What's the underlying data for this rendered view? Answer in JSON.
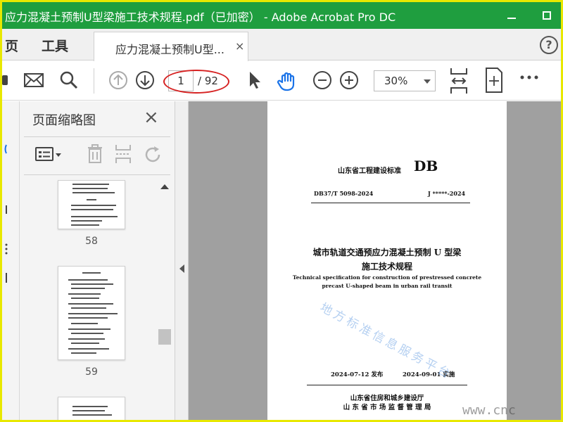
{
  "window": {
    "title": "应力混凝土预制U型梁施工技术规程.pdf（已加密） - Adobe Acrobat Pro DC"
  },
  "tabs": {
    "home": "页",
    "tools": "工具",
    "document_tab": "应力混凝土预制U型...",
    "close_symbol": "×",
    "help_symbol": "?"
  },
  "toolbar": {
    "current_page": "1",
    "total_pages": "/ 92",
    "zoom": "30%"
  },
  "thumbnail_panel": {
    "title": "页面缩略图",
    "close_symbol": "×",
    "pages": [
      {
        "label": "58"
      },
      {
        "label": "59"
      }
    ]
  },
  "document": {
    "standard_label": "山东省工程建设标准",
    "standard_code": "DB",
    "db_number": "DB37/T 5098-2024",
    "j_number": "J *****-2024",
    "cn_title_line1": "城市轨道交通预应力混凝土预制 U 型梁",
    "cn_title_line2": "施工技术规程",
    "en_title_line1": "Technical specification for construction of prestressed concrete",
    "en_title_line2": "precast U-shaped beam in urban rail transit",
    "publish_date": "2024-07-12 发布",
    "implement_date": "2024-09-01 实施",
    "issuer1": "山东省住房和城乡建设厅",
    "issuer2": "山 东 省 市 场 监 督 管 理 局"
  },
  "watermark": {
    "text": "地方标准信息服务平台",
    "url": "www.cnc"
  },
  "colors": {
    "titlebar": "#1f9e3f",
    "frame": "#e8e800",
    "annotation": "#d62222",
    "hand_tool": "#1a73e8"
  }
}
